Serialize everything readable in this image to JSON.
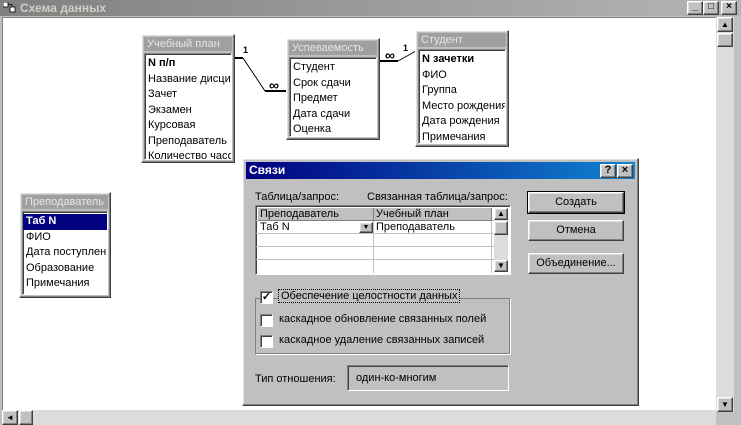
{
  "window": {
    "title": "Схема данных",
    "minimize": "_",
    "maximize": "□",
    "close": "×"
  },
  "tables": {
    "uchebny_plan": {
      "title": "Учебный план",
      "fields": [
        "N п/п",
        "Название дисци",
        "Зачет",
        "Экзамен",
        "Курсовая",
        "Преподаватель",
        "Количество часо"
      ]
    },
    "uspevaemost": {
      "title": "Успеваемость",
      "fields": [
        "Студент",
        "Срок сдачи",
        "Предмет",
        "Дата сдачи",
        "Оценка"
      ]
    },
    "student": {
      "title": "Студент",
      "fields": [
        "N зачетки",
        "ФИО",
        "Группа",
        "Место рождения",
        "Дата рождения",
        "Примечания"
      ]
    },
    "prepodavatel": {
      "title": "Преподаватель",
      "fields": [
        "Таб N",
        "ФИО",
        "Дата поступлен",
        "Образование",
        "Примечания"
      ]
    }
  },
  "relations": {
    "one": "1",
    "many": "∞"
  },
  "dialog": {
    "title": "Связи",
    "help_btn": "?",
    "close_btn": "×",
    "table_label": "Таблица/запрос:",
    "related_label": "Связанная таблица/запрос:",
    "grid_header": [
      "Преподаватель",
      "Учебный план"
    ],
    "grid_rows": [
      [
        "Таб N",
        "Преподаватель"
      ]
    ],
    "btn_create": "Создать",
    "btn_cancel": "Отмена",
    "btn_join": "Объединение...",
    "integrity_label": "Обеспечение целостности данных",
    "integrity_checked": true,
    "cascade_update_label": "каскадное обновление связанных полей",
    "cascade_update_checked": false,
    "cascade_delete_label": "каскадное удаление связанных записей",
    "cascade_delete_checked": false,
    "relation_type_label": "Тип отношения:",
    "relation_type_value": "один-ко-многим"
  }
}
